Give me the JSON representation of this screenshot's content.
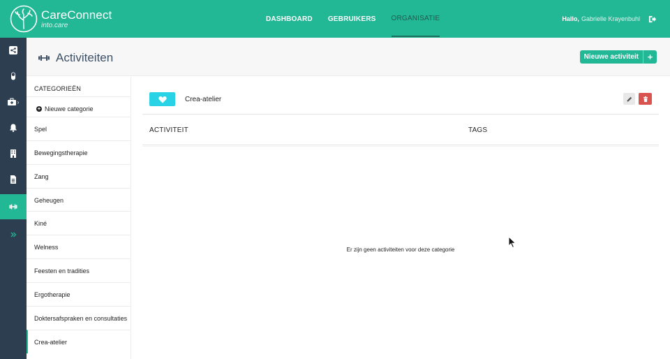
{
  "brand": {
    "name": "CareConnect",
    "subtitle": "into.care"
  },
  "nav": [
    {
      "label": "DASHBOARD",
      "active": false
    },
    {
      "label": "GEBRUIKERS",
      "active": false
    },
    {
      "label": "ORGANISATIE",
      "active": true
    }
  ],
  "user": {
    "greeting": "Hallo,",
    "name": "Gabrielle Krayenbuhl",
    "logout_icon": "sign-out-icon"
  },
  "sidebar_icons": [
    {
      "name": "share-icon",
      "active": false
    },
    {
      "name": "pill-icon",
      "active": false
    },
    {
      "name": "medkit-icon",
      "active": false
    },
    {
      "name": "bell-icon",
      "active": false
    },
    {
      "name": "building-icon",
      "active": false
    },
    {
      "name": "document-icon",
      "active": false
    },
    {
      "name": "dumbbell-icon",
      "active": true
    },
    {
      "name": "double-chevron-right-icon",
      "active": false
    }
  ],
  "page": {
    "title": "Activiteiten",
    "new_activity_label": "Nieuwe activiteit",
    "new_activity_plus": "+"
  },
  "categories": {
    "header": "CATEGORIEËN",
    "new_label": "Nieuwe categorie",
    "items": [
      "Spel",
      "Bewegingstherapie",
      "Zang",
      "Geheugen",
      "Kiné",
      "Welness",
      "Feesten en tradities",
      "Ergotherapie",
      "Doktersafspraken en consultaties",
      "Crea-atelier"
    ],
    "selected": "Crea-atelier"
  },
  "main": {
    "category_name": "Crea-atelier",
    "category_color": "#29d2e4",
    "category_icon": "heart-icon",
    "col_activity": "ACTIVITEIT",
    "col_tags": "TAGS",
    "empty_message": "Er zijn geen activiteiten voor deze categorie"
  },
  "colors": {
    "brand": "#22b795",
    "sidebar": "#2d3e50",
    "danger": "#d9534f"
  }
}
